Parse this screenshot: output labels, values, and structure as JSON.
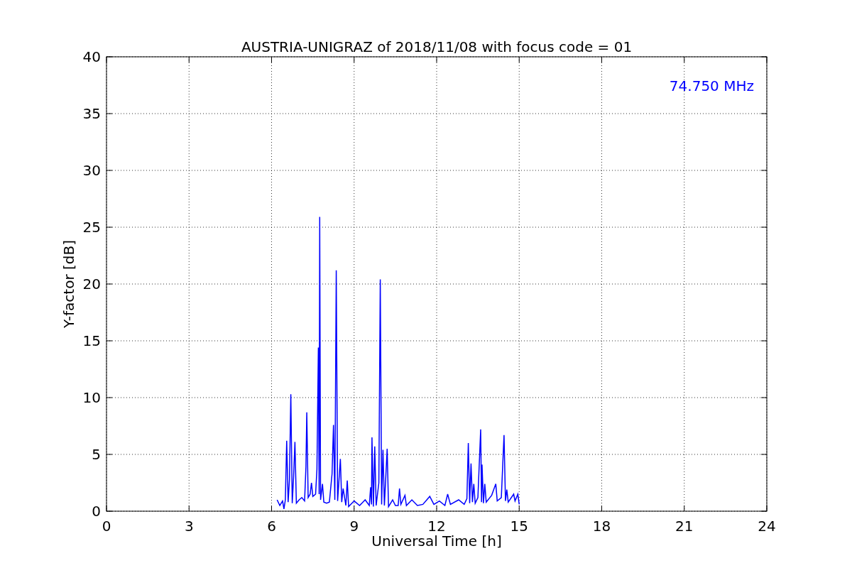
{
  "chart_data": {
    "type": "line",
    "title": "AUSTRIA-UNIGRAZ of 2018/11/08 with focus code = 01",
    "xlabel": "Universal Time [h]",
    "ylabel": "Y-factor [dB]",
    "x": [
      6.2,
      6.3,
      6.4,
      6.45,
      6.5,
      6.55,
      6.6,
      6.65,
      6.7,
      6.75,
      6.8,
      6.85,
      6.9,
      7.0,
      7.1,
      7.2,
      7.25,
      7.28,
      7.33,
      7.4,
      7.45,
      7.5,
      7.6,
      7.65,
      7.7,
      7.73,
      7.75,
      7.78,
      7.85,
      7.9,
      8.0,
      8.1,
      8.2,
      8.25,
      8.3,
      8.35,
      8.4,
      8.5,
      8.55,
      8.6,
      8.7,
      8.75,
      8.8,
      9.0,
      9.2,
      9.4,
      9.55,
      9.6,
      9.63,
      9.65,
      9.7,
      9.75,
      9.8,
      9.9,
      9.95,
      10.0,
      10.05,
      10.1,
      10.2,
      10.25,
      10.4,
      10.5,
      10.6,
      10.65,
      10.7,
      10.85,
      10.9,
      11.1,
      11.3,
      11.5,
      11.75,
      11.9,
      12.1,
      12.3,
      12.4,
      12.5,
      12.8,
      13.0,
      13.1,
      13.15,
      13.2,
      13.25,
      13.3,
      13.35,
      13.4,
      13.5,
      13.6,
      13.63,
      13.65,
      13.7,
      13.75,
      13.8,
      14.0,
      14.15,
      14.2,
      14.35,
      14.45,
      14.5,
      14.55,
      14.6,
      14.8,
      14.85,
      14.95,
      15.0
    ],
    "series": [
      {
        "name": "74.750 MHz",
        "color": "#0000ff",
        "values": [
          1.0,
          0.5,
          0.9,
          0.2,
          1.0,
          6.2,
          0.8,
          2.8,
          10.3,
          0.7,
          3.0,
          6.1,
          0.7,
          1.0,
          1.2,
          0.9,
          3.9,
          8.7,
          1.2,
          1.5,
          2.5,
          1.3,
          1.5,
          3.7,
          14.4,
          1.5,
          25.9,
          1.0,
          2.4,
          0.8,
          0.7,
          0.8,
          3.3,
          7.6,
          1.0,
          21.2,
          0.9,
          4.6,
          0.8,
          2.0,
          0.5,
          2.7,
          0.4,
          0.9,
          0.5,
          1.0,
          0.5,
          2.1,
          0.6,
          6.5,
          0.4,
          5.7,
          0.5,
          2.5,
          20.4,
          0.6,
          5.4,
          0.5,
          5.5,
          0.4,
          1.0,
          0.5,
          0.5,
          2.0,
          0.6,
          1.4,
          0.5,
          1.0,
          0.5,
          0.6,
          1.3,
          0.6,
          0.9,
          0.5,
          1.5,
          0.6,
          1.0,
          0.6,
          1.1,
          6.0,
          0.7,
          4.2,
          0.8,
          2.4,
          0.7,
          1.2,
          7.2,
          0.8,
          4.1,
          0.7,
          2.4,
          0.8,
          1.4,
          2.4,
          0.9,
          1.2,
          6.7,
          0.9,
          1.9,
          0.8,
          1.5,
          0.9,
          1.5,
          0.6
        ]
      }
    ],
    "xlim": [
      0,
      24
    ],
    "ylim": [
      0,
      40
    ],
    "xticks": [
      0,
      3,
      6,
      9,
      12,
      15,
      18,
      21,
      24
    ],
    "yticks": [
      0,
      5,
      10,
      15,
      20,
      25,
      30,
      35,
      40
    ],
    "grid": true
  }
}
